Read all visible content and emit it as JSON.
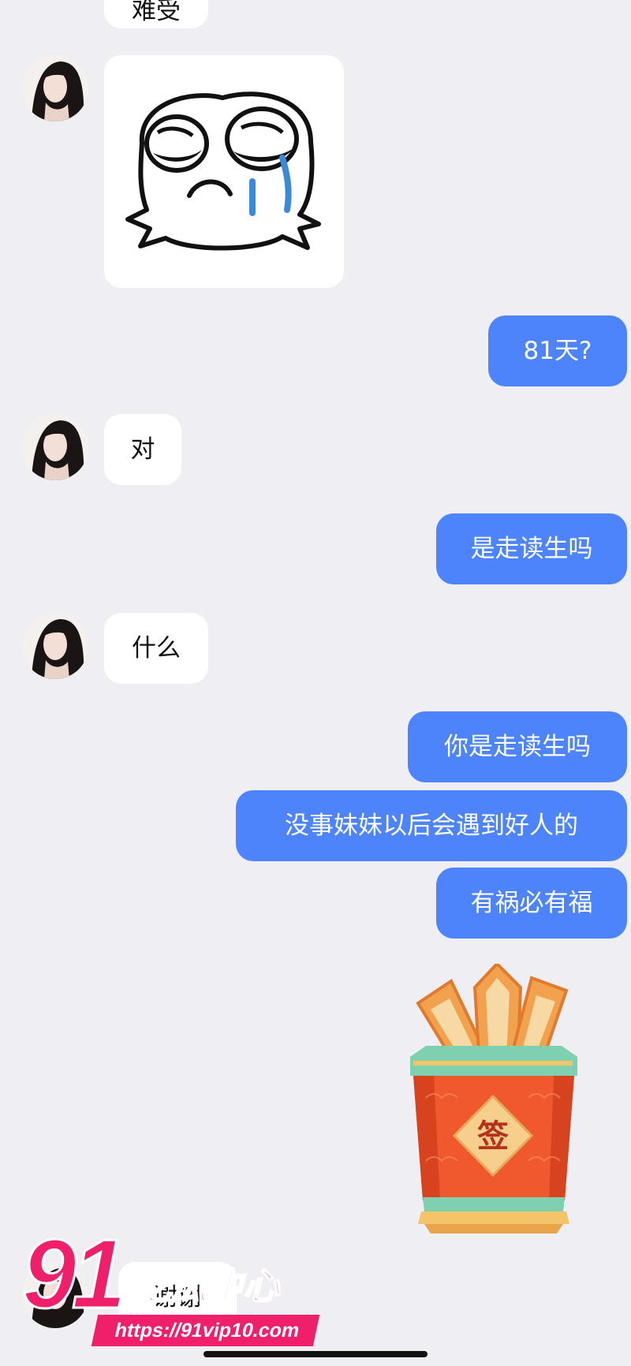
{
  "colors": {
    "background": "#efeff3",
    "incoming_bubble": "#ffffff",
    "outgoing_bubble": "#4d84fb",
    "watermark": "#f01f6b"
  },
  "messages": {
    "m_top_partial": "难受",
    "m_81": "81天?",
    "m_dui": "对",
    "m_walk": "是走读生吗",
    "m_what": "什么",
    "m_you_walk": "你是走读生吗",
    "m_ok": "没事妹妹以后会遇到好人的",
    "m_fortune": "有祸必有福",
    "m_thanks_partial": "谢谢"
  },
  "stickers": {
    "crying_face": "crying-cartoon-face",
    "fortune_tube": "签"
  },
  "watermark": {
    "number": "91",
    "title": "吃瓜中心",
    "url": "https://91vip10.com"
  }
}
